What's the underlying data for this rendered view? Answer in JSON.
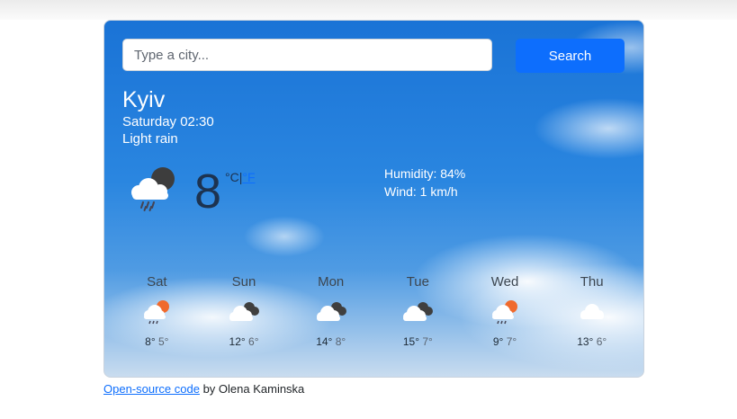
{
  "search": {
    "placeholder": "Type a city...",
    "button_label": "Search"
  },
  "current": {
    "city": "Kyiv",
    "date": "Saturday 02:30",
    "description": "Light rain",
    "temperature": "8",
    "unit_c": "°C",
    "unit_separator": "|",
    "unit_f": "°F",
    "humidity": "Humidity: 84%",
    "wind": "Wind: 1 km/h",
    "icon": "rain-cloud-moon-icon"
  },
  "forecast": [
    {
      "day": "Sat",
      "max": "8°",
      "min": "5°",
      "icon": "rain-sun-icon"
    },
    {
      "day": "Sun",
      "max": "12°",
      "min": "6°",
      "icon": "broken-clouds-icon"
    },
    {
      "day": "Mon",
      "max": "14°",
      "min": "8°",
      "icon": "broken-clouds-icon"
    },
    {
      "day": "Tue",
      "max": "15°",
      "min": "7°",
      "icon": "broken-clouds-icon"
    },
    {
      "day": "Wed",
      "max": "9°",
      "min": "7°",
      "icon": "rain-sun-icon"
    },
    {
      "day": "Thu",
      "max": "13°",
      "min": "6°",
      "icon": "cloud-icon"
    }
  ],
  "footer": {
    "link_text": "Open-source code",
    "suffix": " by Olena Kaminska"
  },
  "colors": {
    "accent": "#0d6efd",
    "sky": "#1a73d6"
  }
}
